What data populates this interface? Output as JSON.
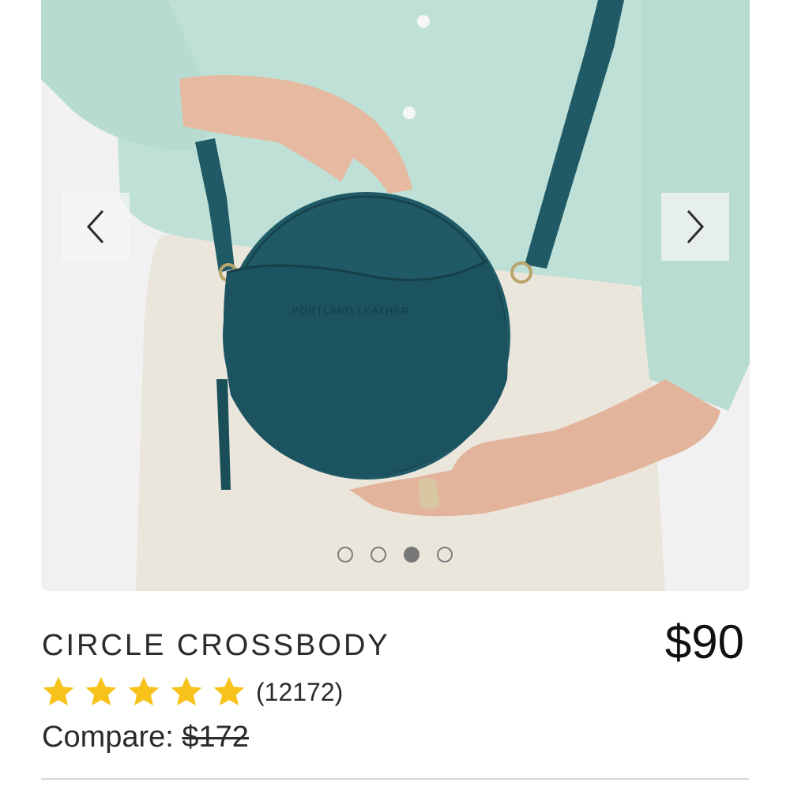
{
  "product": {
    "title": "CIRCLE CROSSBODY",
    "price": "$90",
    "rating_count": "(12172)",
    "rating_stars": 5,
    "compare_label": "Compare:",
    "compare_price": "$172",
    "image_alt": "Circle crossbody leather bag",
    "bag_stamp": "PORTLAND LEATHER"
  },
  "carousel": {
    "total_slides": 4,
    "active_slide": 3,
    "prev_icon": "chevron-left-icon",
    "next_icon": "chevron-right-icon"
  },
  "colors": {
    "star": "#f7c21a",
    "bag": "#1f5a66",
    "sweater": "#bfe0d6"
  }
}
